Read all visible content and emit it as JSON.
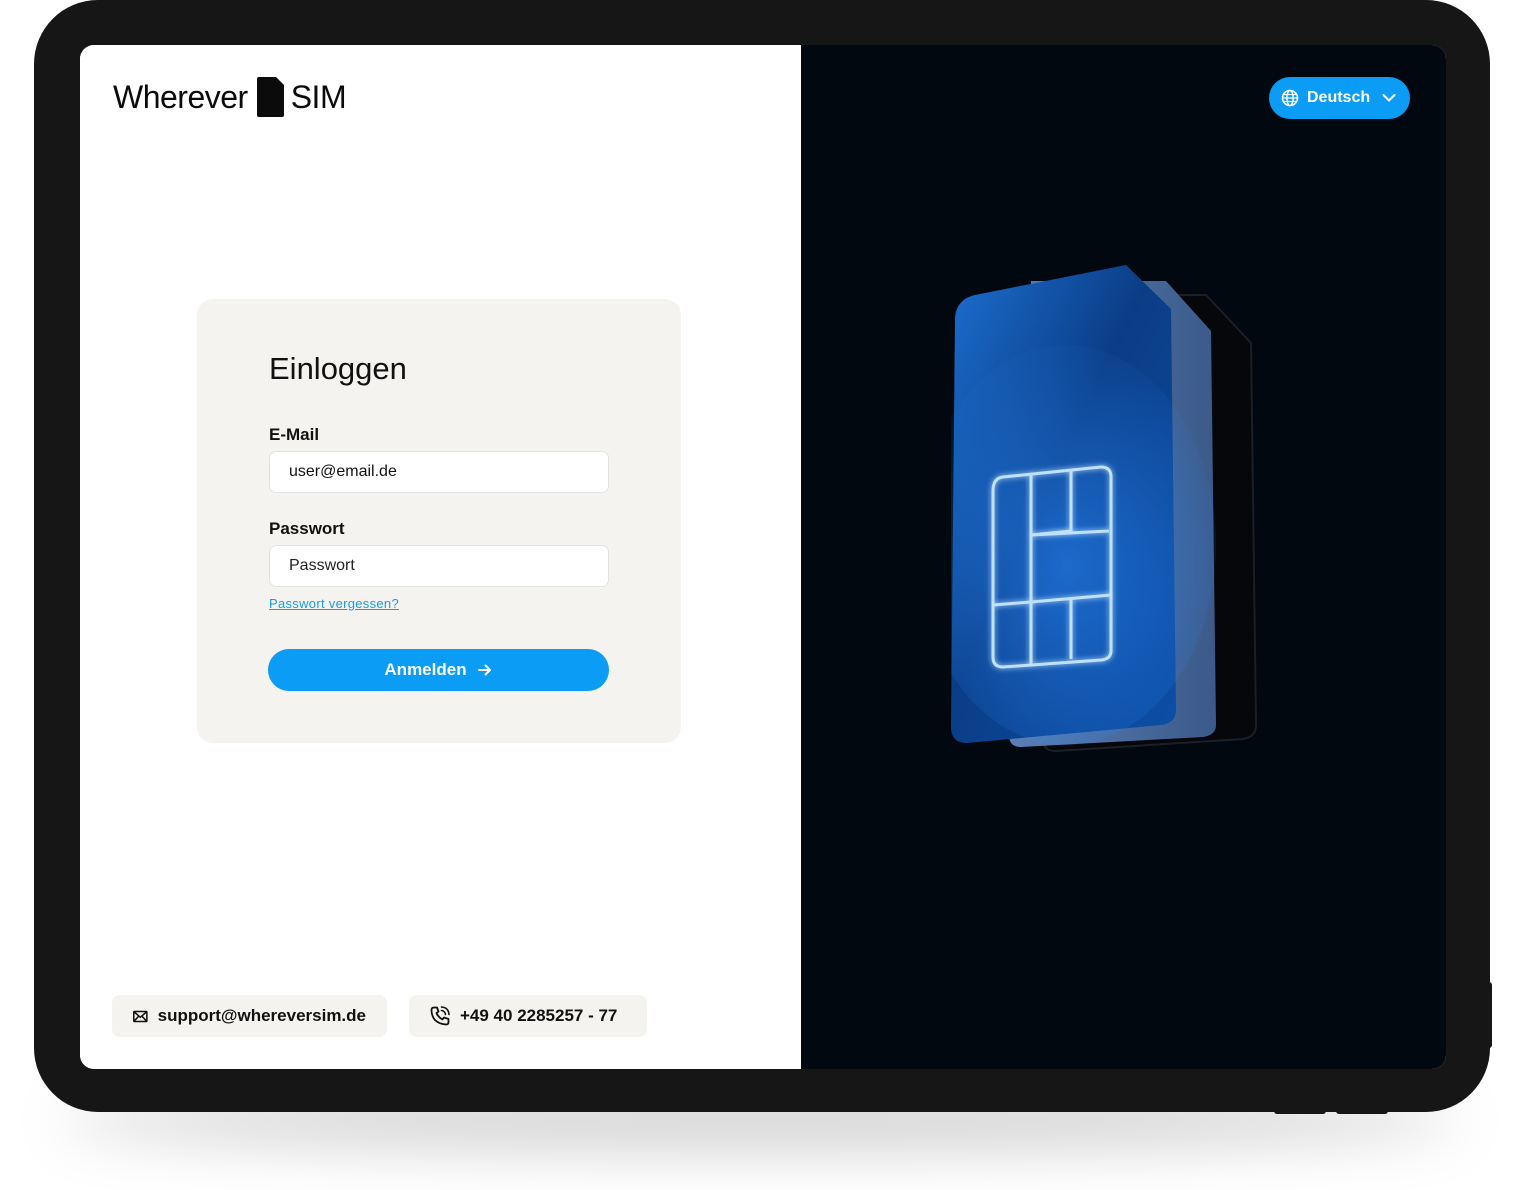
{
  "brand": {
    "logo_left": "Wherever",
    "logo_right": "SIM"
  },
  "login": {
    "title": "Einloggen",
    "email_label": "E-Mail",
    "email_value": "user@email.de",
    "password_label": "Passwort",
    "password_placeholder": "Passwort",
    "forgot_link": "Passwort vergessen?",
    "submit_label": "Anmelden"
  },
  "contact": {
    "email": "support@whereversim.de",
    "phone": "+49 40 2285257 - 77"
  },
  "language": {
    "selected": "Deutsch"
  },
  "colors": {
    "accent": "#0b9cf5",
    "card_bg": "#f4f3ef",
    "dark_bg": "#020810",
    "link": "#1a9be6"
  }
}
